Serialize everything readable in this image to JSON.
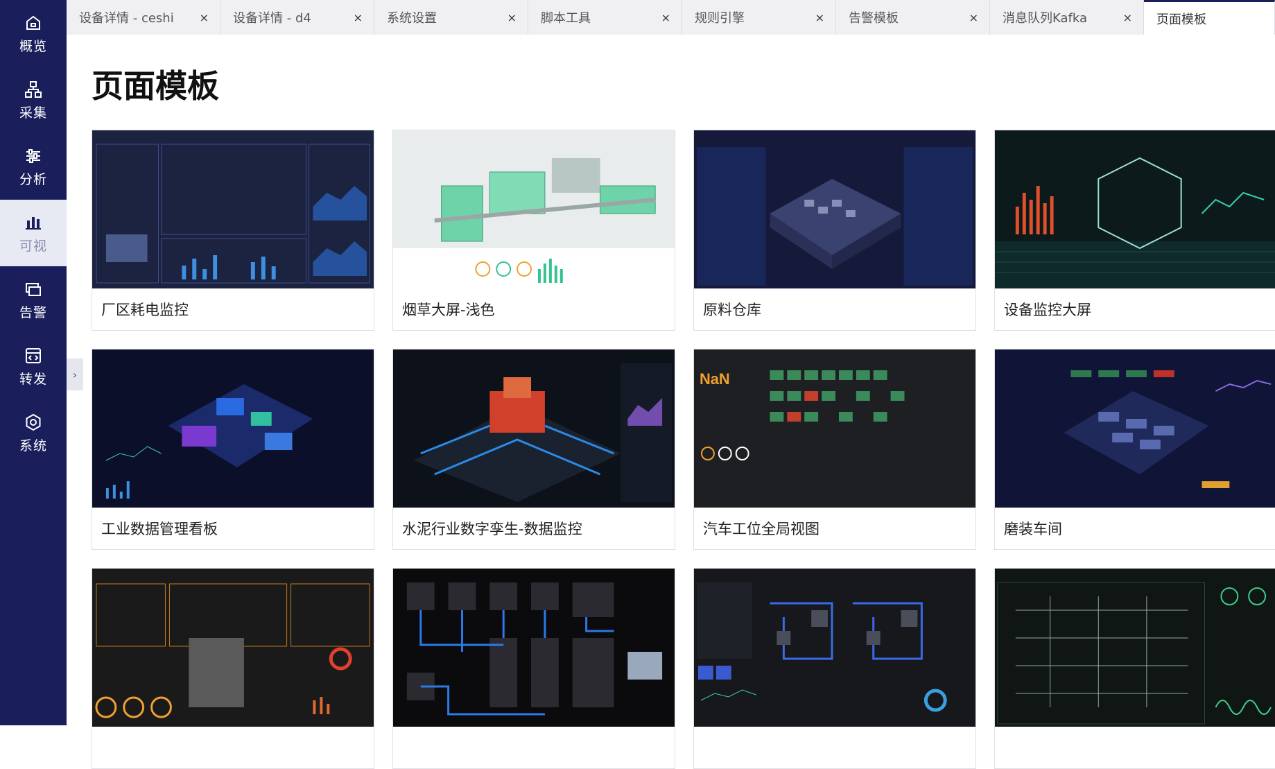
{
  "sidebar": {
    "items": [
      {
        "label": "概览",
        "icon": "home-icon"
      },
      {
        "label": "采集",
        "icon": "hierarchy-icon"
      },
      {
        "label": "分析",
        "icon": "filter-sliders-icon"
      },
      {
        "label": "可视",
        "icon": "bar-chart-icon",
        "active": true
      },
      {
        "label": "告警",
        "icon": "alert-layers-icon"
      },
      {
        "label": "转发",
        "icon": "forward-icon"
      },
      {
        "label": "系统",
        "icon": "hexagon-gear-icon"
      }
    ]
  },
  "tabs": [
    {
      "label": "设备详情 - ceshi",
      "close": "×"
    },
    {
      "label": "设备详情 - d4",
      "close": "×"
    },
    {
      "label": "系统设置",
      "close": "×"
    },
    {
      "label": "脚本工具",
      "close": "×"
    },
    {
      "label": "规则引擎",
      "close": "×"
    },
    {
      "label": "告警模板",
      "close": "×"
    },
    {
      "label": "消息队列Kafka",
      "close": "×"
    },
    {
      "label": "页面模板",
      "close": "",
      "active": true
    }
  ],
  "page": {
    "title": "页面模板"
  },
  "templates": [
    {
      "label": "厂区耗电监控",
      "theme": "#1c2340"
    },
    {
      "label": "烟草大屏-浅色",
      "theme": "#e9ecec"
    },
    {
      "label": "原料仓库",
      "theme": "#151a3b"
    },
    {
      "label": "设备监控大屏",
      "theme": "#0c1a1c"
    },
    {
      "label": "工业数据管理看板",
      "theme": "#0b0f2a"
    },
    {
      "label": "水泥行业数字孪生-数据监控",
      "theme": "#0d121a"
    },
    {
      "label": "汽车工位全局视图",
      "theme": "#1e1f22"
    },
    {
      "label": "磨装车间",
      "theme": "#101538"
    },
    {
      "label": "",
      "theme": "#1b1a1a"
    },
    {
      "label": "",
      "theme": "#0b0b0d"
    },
    {
      "label": "",
      "theme": "#17181c"
    },
    {
      "label": "",
      "theme": "#0f1614"
    }
  ],
  "colors": {
    "sidebar": "#1a1f5c",
    "active_bg": "#e8eaf3"
  }
}
